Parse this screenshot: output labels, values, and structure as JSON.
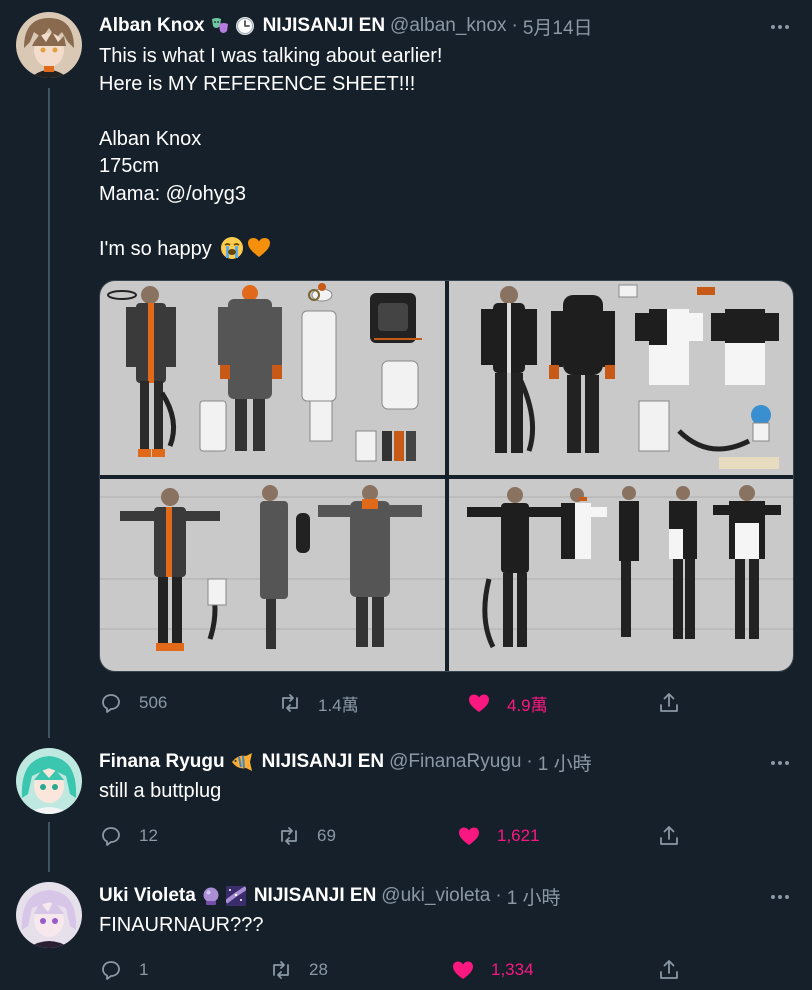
{
  "tweets": [
    {
      "name": "Alban Knox",
      "agency": "NIJISANJI EN",
      "handle": "@alban_knox",
      "separator": "·",
      "time": "5月14日",
      "text": "This is what I was talking about earlier!\nHere is MY REFERENCE SHEET!!!\n\nAlban Knox\n175cm\nMama: @/ohyg3\n\nI'm so happy",
      "replies": "506",
      "retweets": "1.4萬",
      "likes": "4.9萬",
      "liked": true,
      "badge_icons": [
        "performing-arts-icon",
        "clock-icon"
      ],
      "end_emoji": [
        "loudly-crying-face-icon",
        "orange-heart-icon"
      ]
    },
    {
      "name": "Finana Ryugu",
      "agency": "NIJISANJI EN",
      "handle": "@FinanaRyugu",
      "separator": "·",
      "time": "1 小時",
      "text": "still a buttplug",
      "replies": "12",
      "retweets": "69",
      "likes": "1,621",
      "liked": true,
      "badge_icons": [
        "tropical-fish-icon"
      ]
    },
    {
      "name": "Uki Violeta",
      "agency": "NIJISANJI EN",
      "handle": "@uki_violeta",
      "separator": "·",
      "time": "1 小時",
      "text": "FINAURNAUR???",
      "replies": "1",
      "retweets": "28",
      "likes": "1,334",
      "liked": true,
      "badge_icons": [
        "crystal-ball-icon",
        "milky-way-icon"
      ]
    }
  ],
  "colors": {
    "background": "#15202b",
    "secondary_text": "#8b98a5",
    "like_pink": "#f91880",
    "thread_line": "#3d5466",
    "sheet_background": "#c8c8c8"
  }
}
